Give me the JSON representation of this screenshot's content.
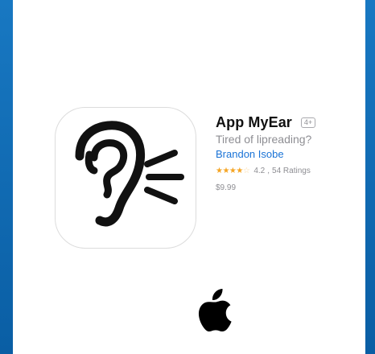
{
  "app": {
    "title": "App MyEar",
    "age_rating": "4+",
    "subtitle": "Tired of lipreading?",
    "developer": "Brandon Isobe",
    "rating_value": "4.2",
    "rating_stars_fraction": 0.84,
    "ratings_count_label": "54 Ratings",
    "price": "$9.99",
    "icon_name": "ear-sound-icon"
  },
  "branding": {
    "logo_name": "apple-logo-icon"
  },
  "colors": {
    "background_frame": "#0a6db8",
    "card": "#ffffff",
    "title": "#111111",
    "secondary_text": "#8e8e93",
    "developer_link": "#1a73d6",
    "star": "#f5a524"
  }
}
